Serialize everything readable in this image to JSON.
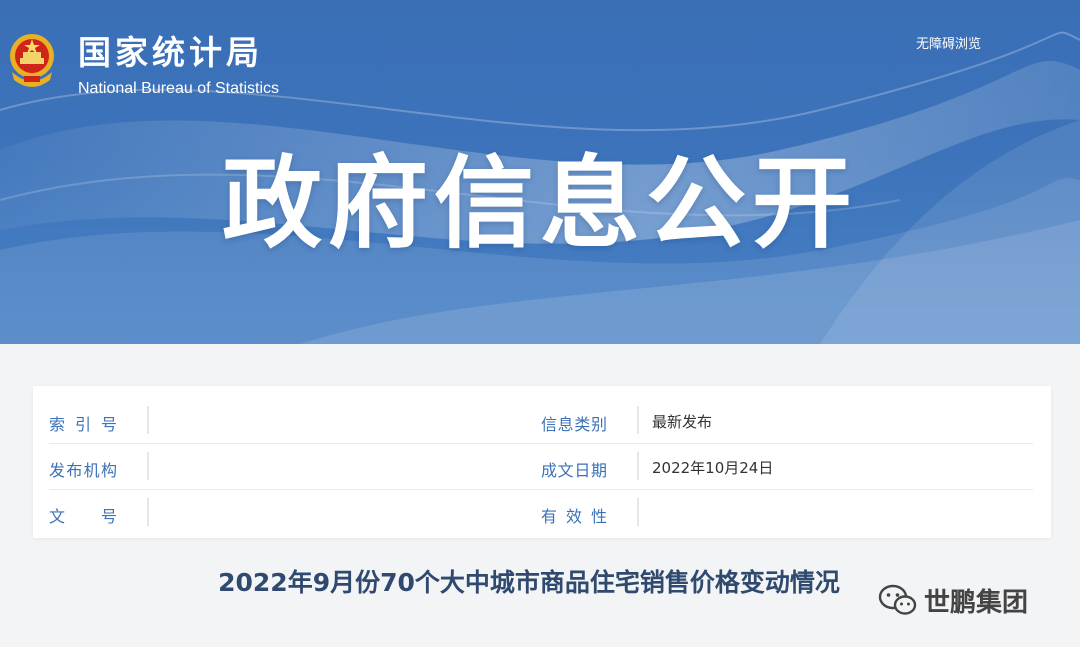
{
  "header": {
    "org_name_cn": "国家统计局",
    "org_name_en": "National Bureau of Statistics",
    "accessibility_link": "无障碍浏览",
    "hero_title": "政府信息公开"
  },
  "info_table": {
    "index_label": "索引号",
    "index_value": "",
    "category_label": "信息类别",
    "category_value": "最新发布",
    "publisher_label": "发布机构",
    "publisher_value": "",
    "date_label": "成文日期",
    "date_value": "2022年10月24日",
    "doc_no_label": "文号",
    "doc_no_value": "",
    "validity_label": "有效性",
    "validity_value": ""
  },
  "document": {
    "title": "2022年9月份70个大中城市商品住宅销售价格变动情况"
  },
  "watermark": {
    "text": "世鹏集团"
  },
  "colors": {
    "banner_blue": "#3c73ba",
    "label_blue": "#3b72b8",
    "title_navy": "#2f4a6e"
  }
}
